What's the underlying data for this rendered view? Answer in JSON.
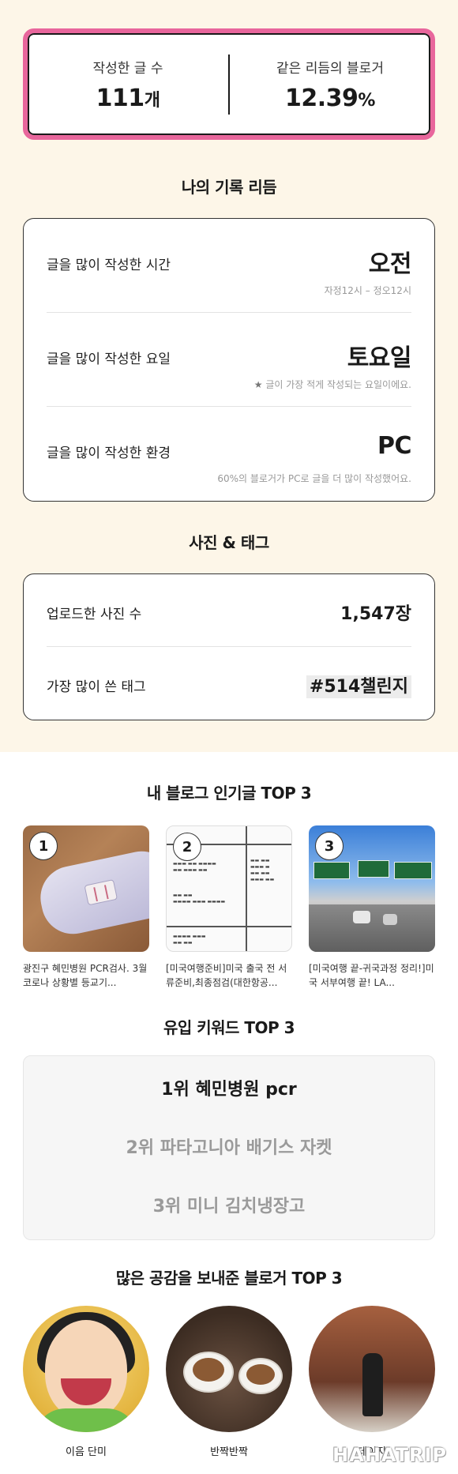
{
  "stats": {
    "posts_label": "작성한 글 수",
    "posts_value": "111",
    "posts_unit": "개",
    "rhythm_label": "같은 리듬의 블로거",
    "rhythm_value": "12.39",
    "rhythm_unit": "%"
  },
  "rhythm": {
    "title": "나의 기록 리듬",
    "rows": [
      {
        "label": "글을 많이 작성한 시간",
        "value": "오전",
        "note": "자정12시 – 정오12시"
      },
      {
        "label": "글을 많이 작성한 요일",
        "value": "토요일",
        "note": "글이 가장 적게 작성되는 요일이에요.",
        "note_icon": "★"
      },
      {
        "label": "글을 많이 작성한 환경",
        "value": "PC",
        "note": "60%의 블로거가 PC로 글을 더 많이 작성했어요."
      }
    ]
  },
  "photo": {
    "title": "사진 & 태그",
    "uploads_label": "업로드한 사진 수",
    "uploads_value": "1,547장",
    "tag_label": "가장 많이 쓴 태그",
    "tag_value": "#514챌린지"
  },
  "popular": {
    "title": "내 블로그 인기글 TOP 3",
    "posts": [
      {
        "rank": "1",
        "title": "광진구 혜민병원 PCR검사. 3월 코로나 상황별 등교기..."
      },
      {
        "rank": "2",
        "title": "[미국여행준비]미국 출국 전 서류준비,최종점검(대한항공..."
      },
      {
        "rank": "3",
        "title": "[미국여행 끝-귀국과정 정리!]미국 서부여행 끝! LA..."
      }
    ]
  },
  "keywords": {
    "title": "유입 키워드 TOP 3",
    "items": [
      "1위 혜민병원 pcr",
      "2위 파타고니아 배기스 자켓",
      "3위 미니 김치냉장고"
    ]
  },
  "fans": {
    "title": "많은 공감을 보내준 블로거 TOP 3",
    "items": [
      "이음 단미",
      "반짝반짝",
      "데이지"
    ]
  },
  "watermark": "HAHATRIP",
  "colors": {
    "accent_border": "#e8669c",
    "top_background": "#fdf6e8"
  }
}
